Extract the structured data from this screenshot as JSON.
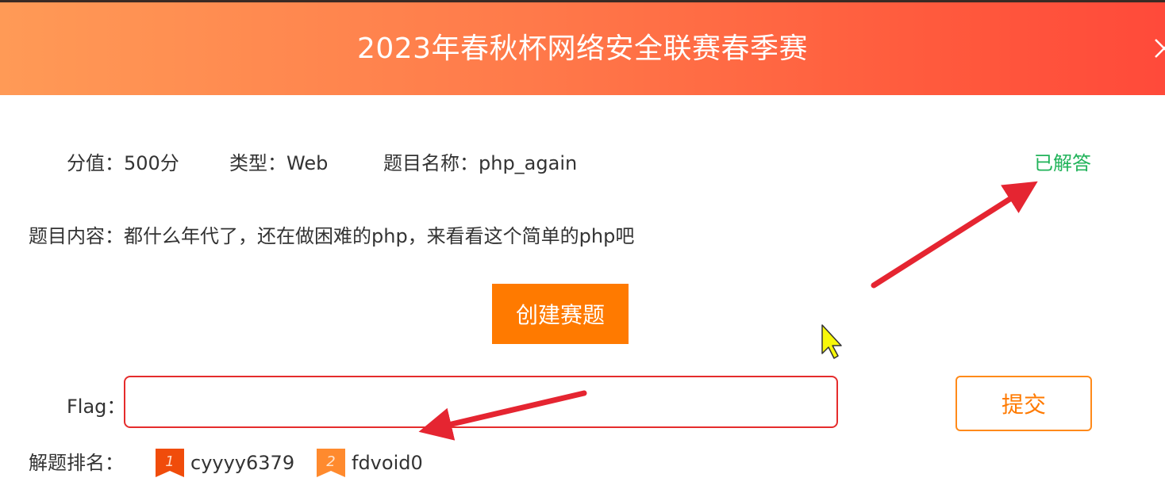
{
  "header": {
    "title": "2023年春秋杯网络安全联赛春季赛"
  },
  "info": {
    "score": "分值：500分",
    "type": "类型：Web",
    "name": "题目名称：php_again",
    "status": "已解答"
  },
  "content": {
    "text": "题目内容：都什么年代了，还在做困难的php，来看看这个简单的php吧"
  },
  "buttons": {
    "create_label": "创建赛题",
    "submit_label": "提交"
  },
  "flag": {
    "label": "Flag：",
    "value": "",
    "placeholder": ""
  },
  "ranking": {
    "label": "解题排名：",
    "items": [
      {
        "rank": "1",
        "name": "cyyyy6379",
        "color": "#f04c0b"
      },
      {
        "rank": "2",
        "name": "fdvoid0",
        "color": "#ff8a2e"
      }
    ]
  },
  "colors": {
    "accent": "#ff7a00",
    "status_green": "#21b35a",
    "annotation_red": "#e52531",
    "header_start": "#ff9a56",
    "header_end": "#ff4a3a"
  },
  "icons": [
    "close-icon",
    "rank-1-badge-icon",
    "rank-2-badge-icon",
    "cursor-arrow-icon"
  ]
}
